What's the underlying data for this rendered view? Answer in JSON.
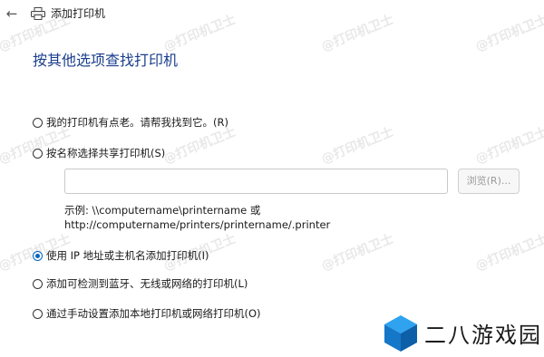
{
  "header": {
    "back_icon": "back-arrow-icon",
    "printer_icon": "printer-icon",
    "title": "添加打印机"
  },
  "heading": "按其他选项查找打印机",
  "options": [
    {
      "label": "我的打印机有点老。请帮我找到它。(R)",
      "checked": false
    },
    {
      "label": "按名称选择共享打印机(S)",
      "checked": false
    },
    {
      "label": "使用 IP 地址或主机名添加打印机(I)",
      "checked": true
    },
    {
      "label": "添加可检测到蓝牙、无线或网络的打印机(L)",
      "checked": false
    },
    {
      "label": "通过手动设置添加本地打印机或网络打印机(O)",
      "checked": false
    }
  ],
  "share": {
    "value": "",
    "browse_label": "浏览(R)...",
    "example_line1": "示例: \\\\computername\\printername 或",
    "example_line2": "http://computername/printers/printername/.printer"
  },
  "watermark": "@打印机卫士",
  "logo": {
    "text": "二八游戏园",
    "colors": {
      "top": "#2fa3f0",
      "left": "#1577c8",
      "right": "#0d5fa8"
    }
  },
  "colors": {
    "heading": "#1a3e8c",
    "accent": "#0067c0"
  }
}
